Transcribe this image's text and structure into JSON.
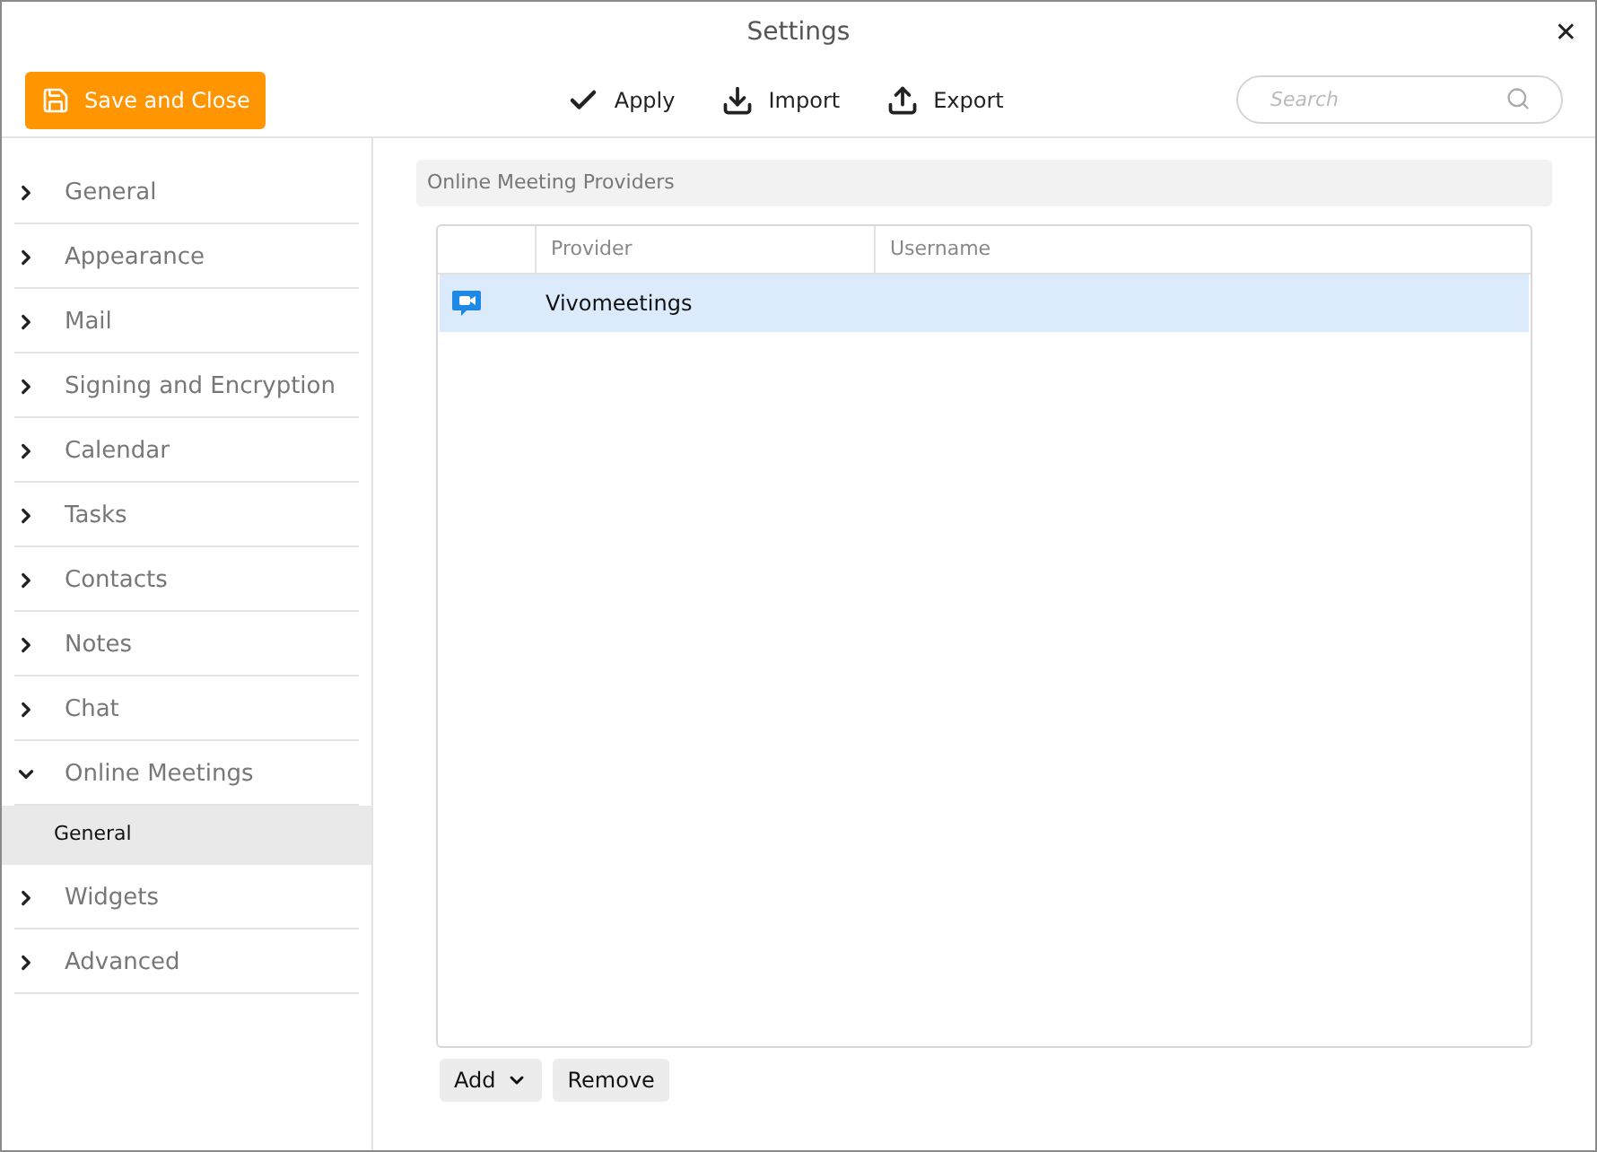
{
  "window": {
    "title": "Settings",
    "close": "✕"
  },
  "toolbar": {
    "save_button": "Save and Close",
    "actions": [
      {
        "label": "Apply",
        "kind": "check"
      },
      {
        "label": "Import",
        "kind": "import"
      },
      {
        "label": "Export",
        "kind": "export"
      }
    ],
    "search": {
      "placeholder": "Search"
    }
  },
  "sidebar": {
    "items": [
      {
        "label": "General",
        "expanded": false
      },
      {
        "label": "Appearance",
        "expanded": false
      },
      {
        "label": "Mail",
        "expanded": false
      },
      {
        "label": "Signing and Encryption",
        "expanded": false
      },
      {
        "label": "Calendar",
        "expanded": false
      },
      {
        "label": "Tasks",
        "expanded": false
      },
      {
        "label": "Contacts",
        "expanded": false
      },
      {
        "label": "Notes",
        "expanded": false
      },
      {
        "label": "Chat",
        "expanded": false
      },
      {
        "label": "Online Meetings",
        "expanded": true,
        "children": [
          {
            "label": "General",
            "selected": true
          }
        ]
      },
      {
        "label": "Widgets",
        "expanded": false
      },
      {
        "label": "Advanced",
        "expanded": false
      }
    ]
  },
  "section": {
    "title": "Online Meeting Providers"
  },
  "table": {
    "columns": [
      "Provider",
      "Username"
    ],
    "rows": [
      {
        "provider": "Vivomeetings",
        "selected": true
      }
    ]
  },
  "buttons": {
    "add": "Add",
    "remove": "Remove"
  }
}
